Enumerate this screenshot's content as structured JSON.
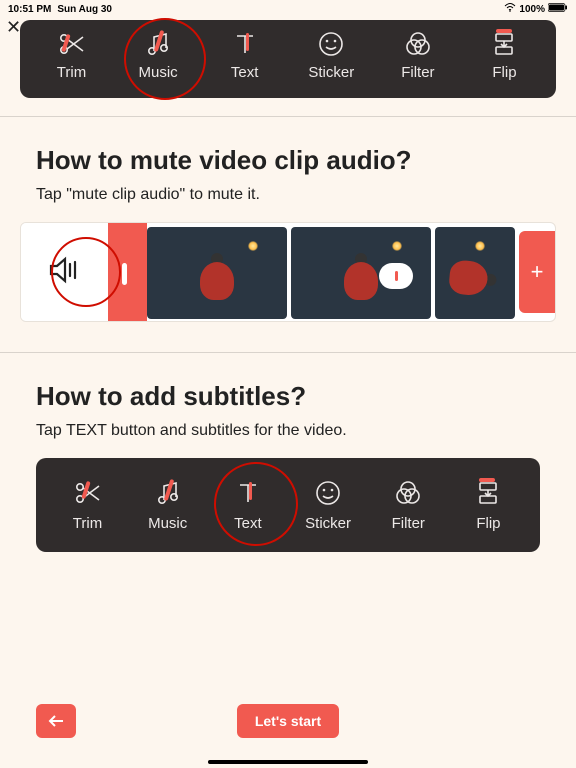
{
  "status": {
    "time": "10:51 PM",
    "date": "Sun Aug 30",
    "battery": "100%"
  },
  "tools": {
    "trim": "Trim",
    "music": "Music",
    "text": "Text",
    "sticker": "Sticker",
    "filter": "Filter",
    "flip": "Flip"
  },
  "section_mute": {
    "title": "How to mute video clip audio?",
    "body": "Tap \"mute clip audio\" to mute it."
  },
  "section_subtitles": {
    "title": "How to add subtitles?",
    "body": "Tap TEXT button and subtitles for the video."
  },
  "buttons": {
    "start": "Let's start"
  },
  "timeline": {
    "add": "+"
  }
}
